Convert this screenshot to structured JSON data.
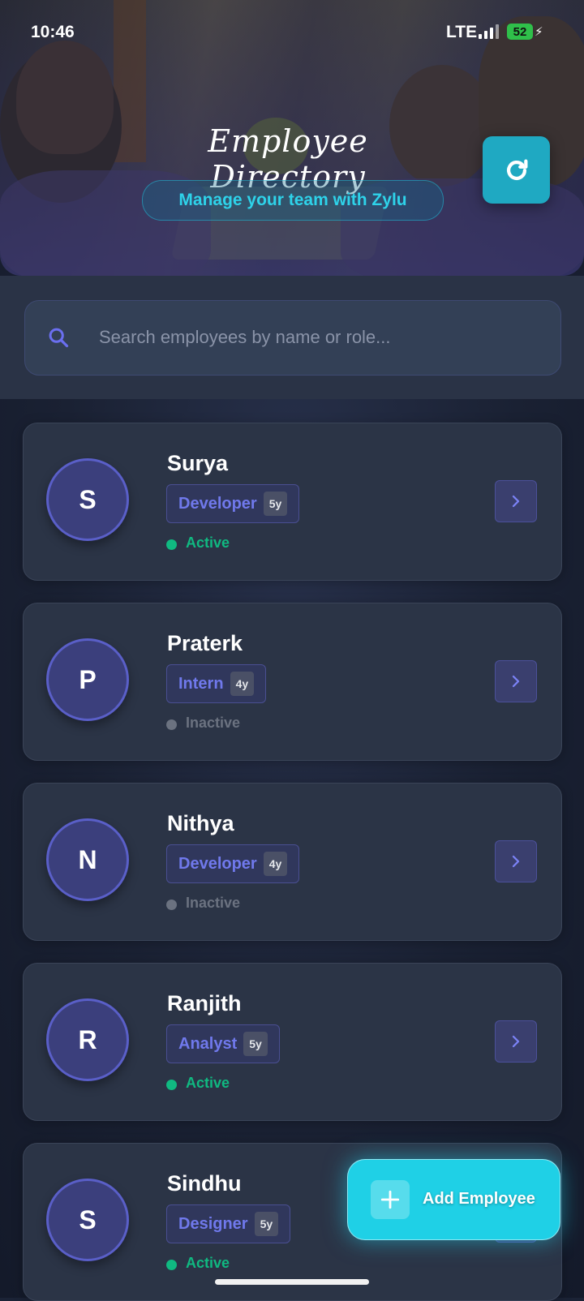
{
  "status_bar": {
    "time": "10:46",
    "network": "LTE",
    "battery": "52"
  },
  "header": {
    "title": "Employee Directory",
    "subtitle": "Manage your team with Zylu",
    "refresh_icon": "refresh-icon"
  },
  "search": {
    "placeholder": "Search employees by name or role...",
    "value": "",
    "icon": "search-icon"
  },
  "employees": [
    {
      "initial": "S",
      "name": "Surya",
      "role": "Developer",
      "years": "5y",
      "status": "Active"
    },
    {
      "initial": "P",
      "name": "Praterk",
      "role": "Intern",
      "years": "4y",
      "status": "Inactive"
    },
    {
      "initial": "N",
      "name": "Nithya",
      "role": "Developer",
      "years": "4y",
      "status": "Inactive"
    },
    {
      "initial": "R",
      "name": "Ranjith",
      "role": "Analyst",
      "years": "5y",
      "status": "Active"
    },
    {
      "initial": "S",
      "name": "Sindhu",
      "role": "Designer",
      "years": "5y",
      "status": "Active"
    }
  ],
  "fab": {
    "label": "Add Employee",
    "icon": "plus-icon"
  },
  "colors": {
    "accent_cyan": "#1fd0e6",
    "role_text": "#7079ec",
    "active": "#10b981",
    "inactive": "#6b7280",
    "background": "#1b2336"
  }
}
